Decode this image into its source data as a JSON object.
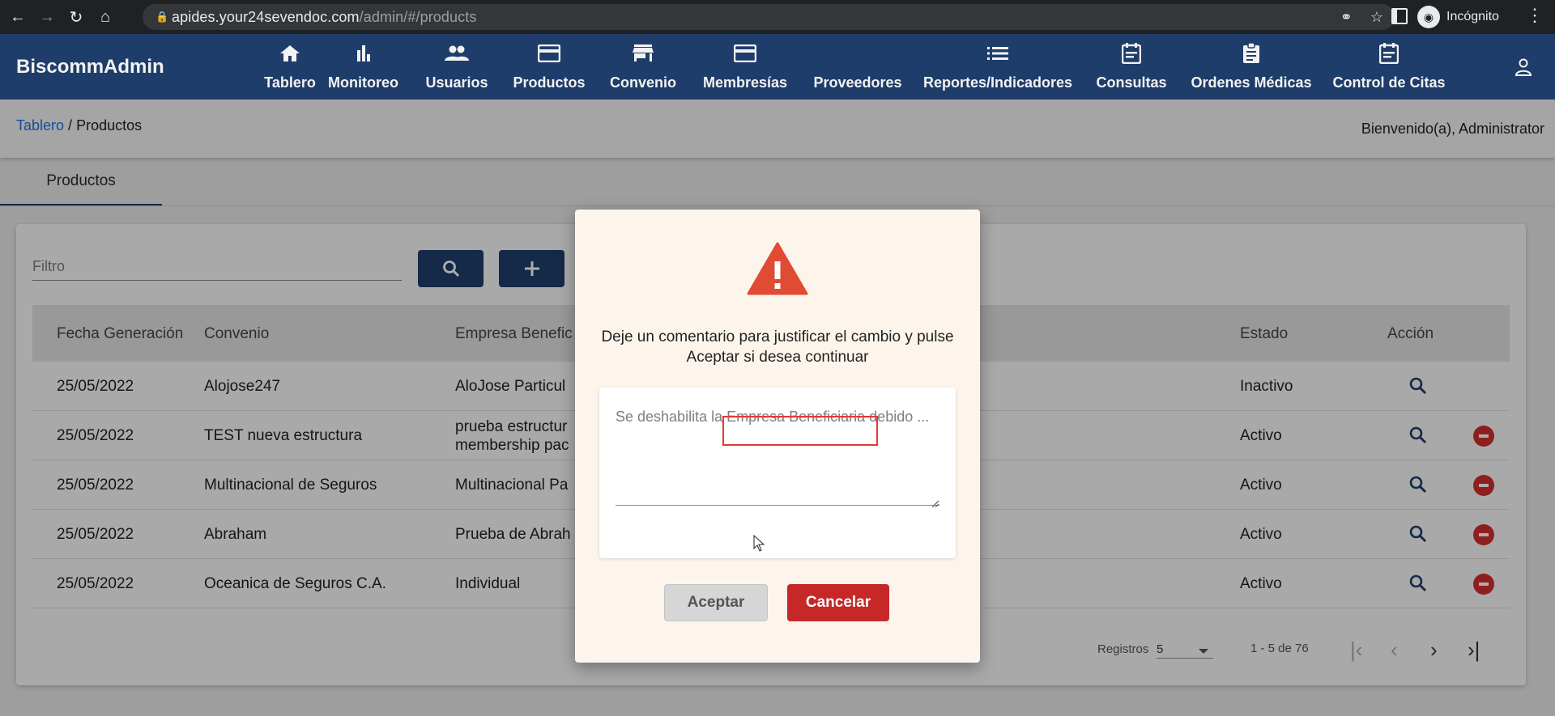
{
  "browser": {
    "url_host": "apides.your24sevendoc.com",
    "url_path": "/admin/#/products",
    "profile_label": "Incógnito"
  },
  "app": {
    "brand": "BiscommAdmin",
    "menu": [
      {
        "label": "Tablero",
        "icon": "home-icon"
      },
      {
        "label": "Monitoreo",
        "icon": "bar-chart-icon"
      },
      {
        "label": "Usuarios",
        "icon": "people-icon"
      },
      {
        "label": "Productos",
        "icon": "credit-card-icon"
      },
      {
        "label": "Convenio",
        "icon": "store-icon"
      },
      {
        "label": "Membresías",
        "icon": "credit-card-icon"
      },
      {
        "label": "Proveedores",
        "icon": "list-icon"
      },
      {
        "label": "Reportes/Indicadores",
        "icon": "list-icon"
      },
      {
        "label": "Consultas",
        "icon": "event-note-icon"
      },
      {
        "label": "Ordenes Médicas",
        "icon": "assignment-icon"
      },
      {
        "label": "Control de Citas",
        "icon": "event-note-icon"
      }
    ]
  },
  "breadcrumb": {
    "root": "Tablero",
    "sep": " / ",
    "current": "Productos"
  },
  "welcome": "Bienvenido(a), Administrator",
  "tab": "Productos",
  "filter": {
    "placeholder": "Filtro"
  },
  "table": {
    "headers": [
      "Fecha Generación",
      "Convenio",
      "Empresa Benefic",
      "Estado",
      "Acción"
    ],
    "rows": [
      {
        "fecha": "25/05/2022",
        "convenio": "Alojose247",
        "empresa": "AloJose Particul",
        "empresa2": "",
        "estado": "Inactivo"
      },
      {
        "fecha": "25/05/2022",
        "convenio": "TEST nueva estructura",
        "empresa": "prueba estructur",
        "empresa2": "membership pac",
        "estado": "Activo"
      },
      {
        "fecha": "25/05/2022",
        "convenio": "Multinacional de Seguros",
        "empresa": "Multinacional Pa",
        "empresa2": "",
        "estado": "Activo"
      },
      {
        "fecha": "25/05/2022",
        "convenio": "Abraham",
        "empresa": "Prueba de Abrah",
        "empresa2": "",
        "estado": "Activo"
      },
      {
        "fecha": "25/05/2022",
        "convenio": "Oceanica de Seguros C.A.",
        "empresa": "Individual",
        "empresa2": "",
        "estado": "Activo"
      }
    ]
  },
  "paginator": {
    "label": "Registros",
    "page_size": "5",
    "range": "1 - 5 de 76"
  },
  "modal": {
    "message": "Deje un comentario para justificar el cambio y pulse Aceptar si desea continuar",
    "comment_value": "Se deshabilita la Empresa Beneficiaria debido ...",
    "accept_label": "Aceptar",
    "cancel_label": "Cancelar"
  },
  "colors": {
    "primary": "#1f3d6a",
    "danger": "#c62828",
    "warning": "#e04b33"
  }
}
